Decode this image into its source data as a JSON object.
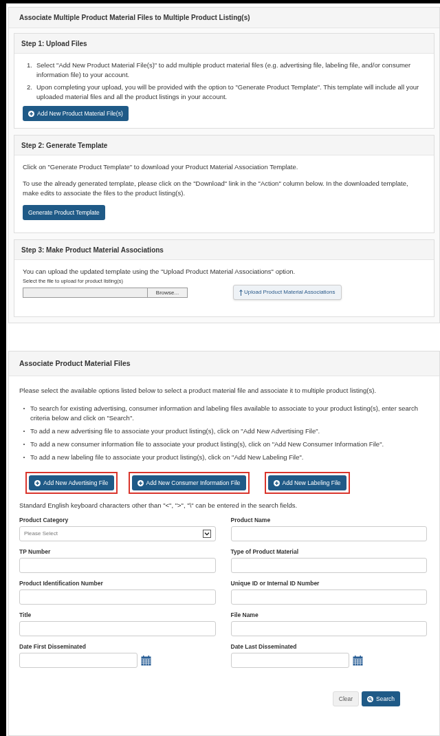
{
  "page_title": "Associate Multiple Product Material Files to Multiple Product Listing(s)",
  "step1": {
    "title": "Step 1: Upload Files",
    "items": [
      {
        "number": "1.",
        "text": "Select \"Add New Product Material File(s)\" to add multiple product material files (e.g. advertising file, labeling file, and/or consumer information file) to your account."
      },
      {
        "number": "2.",
        "text": "Upon completing your upload, you will be provided with the option to \"Generate Product Template\". This template will include all your uploaded material files and all the product listings in your account."
      }
    ],
    "button": "Add New Product Material File(s)"
  },
  "step2": {
    "title": "Step 2: Generate Template",
    "paragraphs": [
      "Click on \"Generate Product Template\" to download your Product Material Association Template.",
      "To use the already generated template, please click on the \"Download\" link in the \"Action\" column below. In the downloaded template, make edits to associate the files to the product listing(s)."
    ],
    "button": "Generate Product Template"
  },
  "step3": {
    "title": "Step 3: Make Product Material Associations",
    "text": "You can upload the updated template using the \"Upload Product Material Associations\" option.",
    "file_label": "Select the file to upload for product listing(s)",
    "browse_button": "Browse...",
    "upload_button": "Upload Product Material Associations"
  },
  "associate": {
    "title": "Associate Product Material Files",
    "intro": "Please select the available options listed below to select a product material file and associate it to multiple product listing(s).",
    "bullets": [
      "To search for existing advertising, consumer information and labeling files available to associate to your product listing(s), enter search criteria below and click on \"Search\".",
      "To add a new advertising file to associate your product listing(s), click on \"Add New Advertising File\".",
      "To add a new consumer information file to associate your product listing(s), click on \"Add New Consumer Information File\".",
      "To add a new labeling file to associate your product listing(s), click on \"Add New Labeling File\"."
    ],
    "buttons": [
      {
        "label": "Add New Advertising File",
        "highlighted": true
      },
      {
        "label": "Add New Consumer Information File",
        "highlighted": true
      },
      {
        "label": "Add New Labeling File",
        "highlighted": true
      }
    ],
    "note": "Standard English keyboard characters other than \"<\", \">\", \"\\\" can be entered in the search fields.",
    "fields": [
      {
        "label": "Product Category",
        "kind": "select",
        "value": "Please Select"
      },
      {
        "label": "Product Name",
        "kind": "text"
      },
      {
        "label": "TP Number",
        "kind": "text"
      },
      {
        "label": "Type of Product Material",
        "kind": "text"
      },
      {
        "label": "Product Identification Number",
        "kind": "text"
      },
      {
        "label": "Unique ID or Internal ID Number",
        "kind": "text"
      },
      {
        "label": "Title",
        "kind": "text"
      },
      {
        "label": "File Name",
        "kind": "text"
      },
      {
        "label": "Date First Disseminated",
        "kind": "date"
      },
      {
        "label": "Date Last Disseminated",
        "kind": "date"
      }
    ],
    "clear_button": "Clear",
    "search_button": "Search"
  }
}
